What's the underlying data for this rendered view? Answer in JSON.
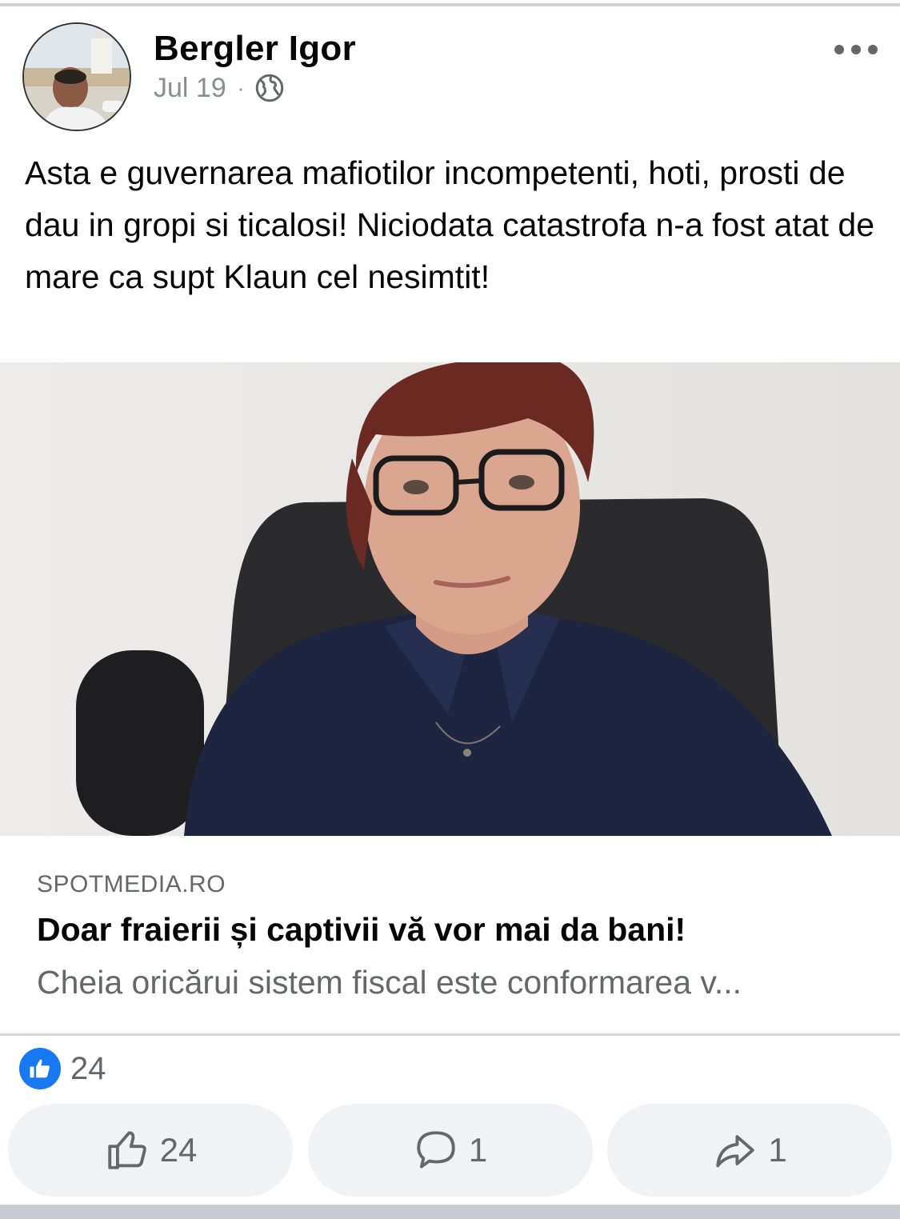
{
  "post": {
    "author": "Bergler Igor",
    "date": "Jul 19",
    "separator": "·",
    "privacy_icon": "globe-icon",
    "text": "Asta e guvernarea mafiotilor incompetenti, hoti, prosti de dau in gropi si ticalosi! Niciodata catastrofa n-a fost atat de mare ca supt Klaun cel nesimtit!"
  },
  "link": {
    "domain": "SPOTMEDIA.RO",
    "title": "Doar fraierii și captivii vă vor mai da bani!",
    "description": "Cheia oricărui sistem fiscal este conformarea v..."
  },
  "reactions": {
    "icon": "like-icon",
    "count": "24"
  },
  "actions": {
    "like_count": "24",
    "comment_count": "1",
    "share_count": "1"
  },
  "colors": {
    "accent": "#1877f2",
    "muted_text": "#65676b",
    "button_bg": "#f0f2f5"
  }
}
